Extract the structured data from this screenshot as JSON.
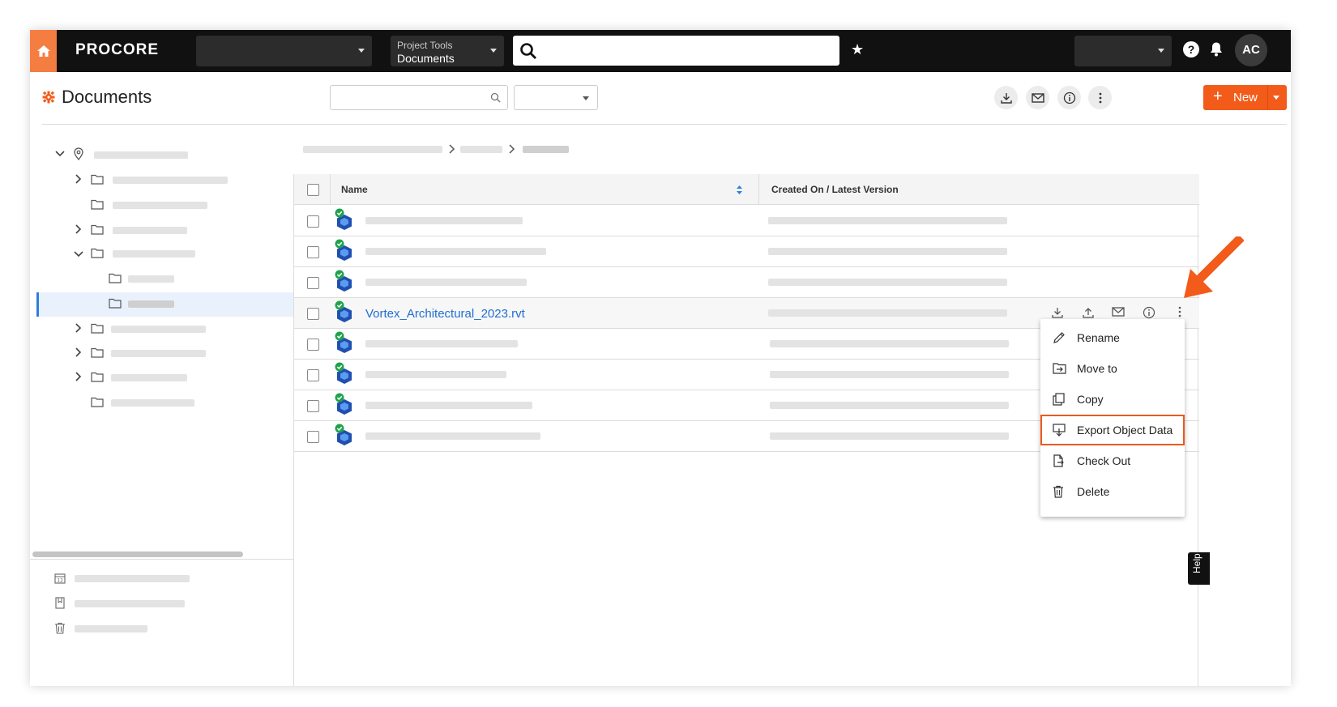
{
  "topnav": {
    "logo": "PROCORE",
    "tools_label": "Project Tools",
    "tools_value": "Documents",
    "avatar_initials": "AC",
    "help_glyph": "?",
    "star_glyph": "★"
  },
  "header": {
    "title": "Documents",
    "new_label": "New",
    "new_plus": "+"
  },
  "table": {
    "columns": [
      "Name",
      "Created On / Latest Version"
    ],
    "visible_file": "Vortex_Architectural_2023.rvt"
  },
  "context_menu": {
    "items": [
      {
        "label": "Rename",
        "icon": "pencil-icon"
      },
      {
        "label": "Move to",
        "icon": "move-to-icon"
      },
      {
        "label": "Copy",
        "icon": "copy-icon"
      },
      {
        "label": "Export Object Data",
        "icon": "export-icon"
      },
      {
        "label": "Check Out",
        "icon": "check-out-icon"
      },
      {
        "label": "Delete",
        "icon": "trash-icon"
      }
    ]
  },
  "help_tab": "Help",
  "colors": {
    "brand_orange": "#f25b19",
    "nav_bg": "#111111",
    "link_blue": "#1f6fd1",
    "highlight_border": "#ea5b1f",
    "arrow": "#f25b19"
  }
}
